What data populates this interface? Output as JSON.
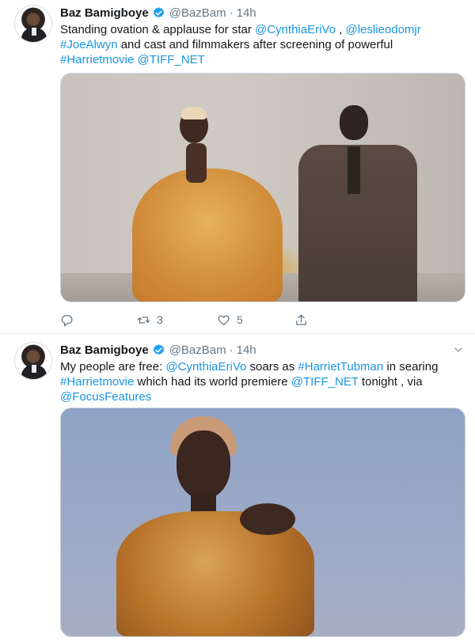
{
  "tweets": [
    {
      "author": {
        "name": "Baz Bamigboye",
        "handle": "@BazBam",
        "time": "14h"
      },
      "text": [
        {
          "t": "Standing ovation & applause for star ",
          "link": false
        },
        {
          "t": "@CynthiaEriVo",
          "link": true
        },
        {
          "t": " , ",
          "link": false
        },
        {
          "t": "@leslieodomjr",
          "link": true
        },
        {
          "t": " ",
          "link": false
        },
        {
          "t": "#JoeAlwyn",
          "link": true
        },
        {
          "t": " and cast and filmmakers after screening of powerful ",
          "link": false
        },
        {
          "t": "#Harrietmovie",
          "link": true
        },
        {
          "t": " ",
          "link": false
        },
        {
          "t": "@TIFF_NET",
          "link": true
        }
      ],
      "actions": {
        "reply_count": "",
        "retweet_count": "3",
        "like_count": "5"
      }
    },
    {
      "author": {
        "name": "Baz Bamigboye",
        "handle": "@BazBam",
        "time": "14h"
      },
      "text": [
        {
          "t": "My people are free: ",
          "link": false
        },
        {
          "t": "@CynthiaEriVo",
          "link": true
        },
        {
          "t": " soars as ",
          "link": false
        },
        {
          "t": "#HarrietTubman",
          "link": true
        },
        {
          "t": " in searing ",
          "link": false
        },
        {
          "t": "#Harrietmovie",
          "link": true
        },
        {
          "t": " which had its world premiere ",
          "link": false
        },
        {
          "t": "@TIFF_NET",
          "link": true
        },
        {
          "t": " tonight , via ",
          "link": false
        },
        {
          "t": "@FocusFeatures",
          "link": true
        }
      ]
    }
  ],
  "colors": {
    "link": "#1b95e0",
    "secondary": "#657786",
    "verified": "#1da1f2"
  },
  "icons": {
    "reply": "reply-icon",
    "retweet": "retweet-icon",
    "like": "heart-icon",
    "share": "share-icon",
    "verified": "verified-badge-icon",
    "menu": "chevron-down-icon"
  }
}
